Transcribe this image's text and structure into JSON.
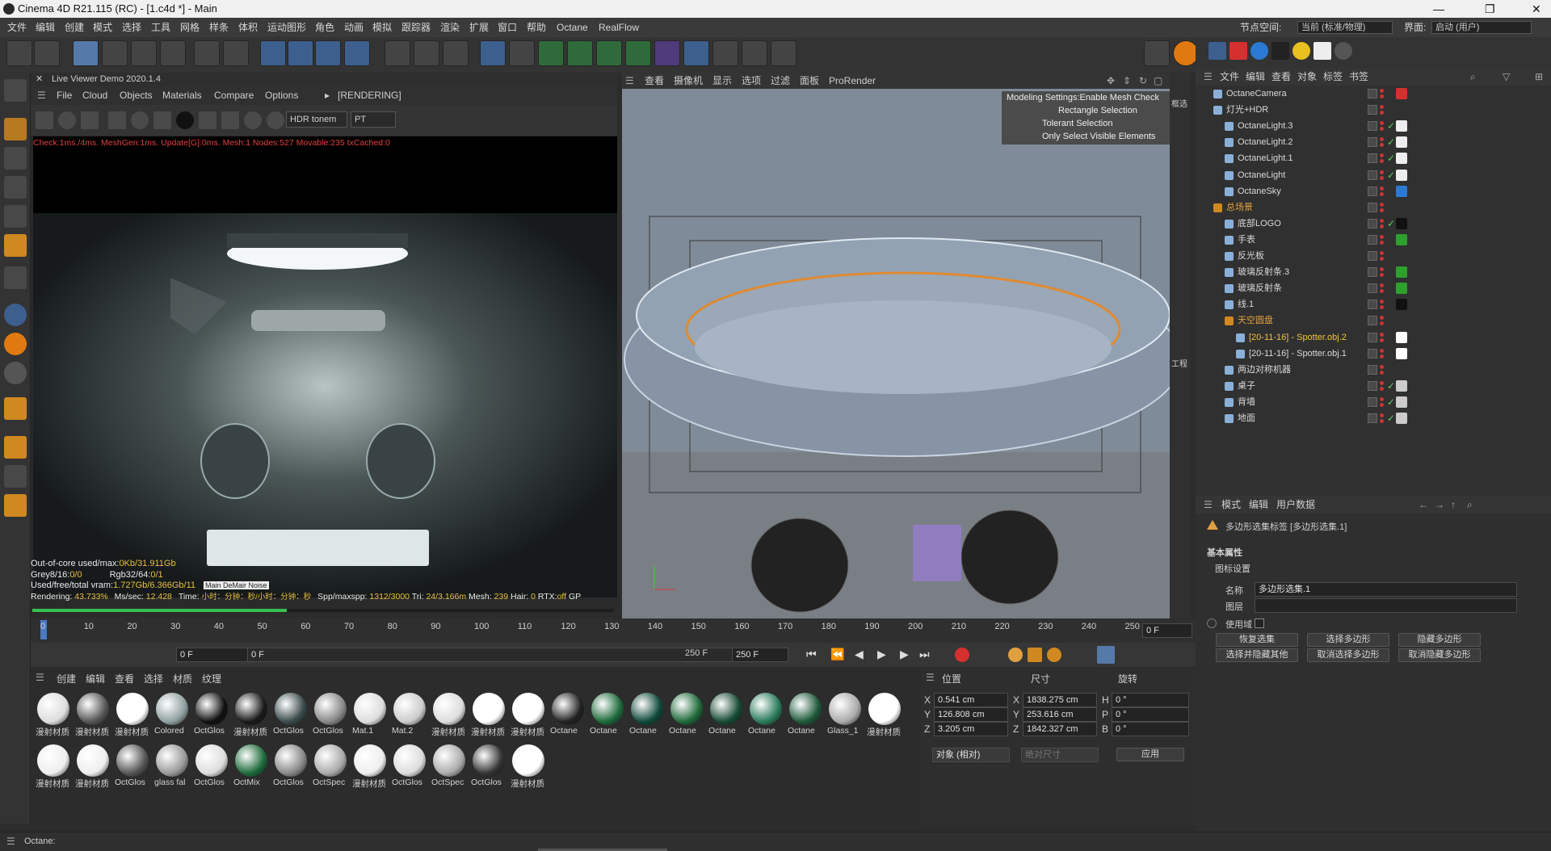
{
  "window": {
    "title": "Cinema 4D R21.115 (RC) - [1.c4d *] - Main",
    "min": "—",
    "max": "❐",
    "close": "✕"
  },
  "menu": {
    "items": [
      "文件",
      "编辑",
      "创建",
      "模式",
      "选择",
      "工具",
      "网格",
      "样条",
      "体积",
      "运动图形",
      "角色",
      "动画",
      "模拟",
      "跟踪器",
      "渲染",
      "扩展",
      "窗口",
      "帮助",
      "Octane",
      "RealFlow"
    ],
    "node_space_label": "节点空间:",
    "node_space_value": "当前 (标准/物理)",
    "layout_label": "界面:",
    "layout_value": "启动 (用户)"
  },
  "live_viewer": {
    "title": "Live Viewer Demo 2020.1.4",
    "menu": [
      "File",
      "Cloud",
      "Objects",
      "Materials",
      "Compare",
      "Options"
    ],
    "status": "[RENDERING]",
    "hdr_select": "HDR tonem",
    "pt_select": "PT",
    "check_line": "Check:1ms./4ms. MeshGen:1ms. Update[G]:0ms. Mesh:1 Nodes:527 Movable:235 txCached:0",
    "stats": {
      "l1_label": "Out-of-core used/max:",
      "l1_value": "0Kb/31.911Gb",
      "l2a_label": "Grey8/16:",
      "l2a_value": "0/0",
      "l2b_label": "Rgb32/64:",
      "l2b_value": "0/1",
      "l3_label": "Used/free/total vram:",
      "l3_value": "1.727Gb/6.366Gb/11",
      "l3_tag": "Main DeMair Noise",
      "r_label": "Rendering:",
      "r_value": "43.733%",
      "ms_label": "Ms/sec:",
      "ms_value": "12.428",
      "time_label": "Time:",
      "time_value": "小时：分钟：秒/小时：分钟：秒",
      "spp_label": "Spp/maxspp:",
      "spp_value": "1312/3000",
      "tri_label": "Tri:",
      "tri_value": "24/3.166m",
      "mesh_label": "Mesh:",
      "mesh_value": "239",
      "hair_label": "Hair:",
      "hair_value": "0",
      "rtx_label": "RTX:",
      "rtx_value": "off",
      "gp": "GP"
    },
    "progress": 0.437
  },
  "viewport": {
    "menu": [
      "查看",
      "摄像机",
      "显示",
      "选项",
      "过滤",
      "面板",
      "ProRender"
    ],
    "tooltip": [
      "Modeling Settings:Enable Mesh Check",
      "Rectangle Selection",
      "Tolerant Selection",
      "Only Select Visible Elements"
    ],
    "side_labels": [
      "框选",
      "工程"
    ]
  },
  "object_manager": {
    "menu": [
      "文件",
      "编辑",
      "查看",
      "对象",
      "标签",
      "书签"
    ],
    "rows": [
      {
        "name": "OctaneCamera",
        "indent": 0,
        "color": "#d9d9d9"
      },
      {
        "name": "灯光+HDR",
        "indent": 0,
        "color": "#d9d9d9"
      },
      {
        "name": "OctaneLight.3",
        "indent": 1,
        "color": "#d9d9d9"
      },
      {
        "name": "OctaneLight.2",
        "indent": 1,
        "color": "#d9d9d9"
      },
      {
        "name": "OctaneLight.1",
        "indent": 1,
        "color": "#d9d9d9"
      },
      {
        "name": "OctaneLight",
        "indent": 1,
        "color": "#d9d9d9"
      },
      {
        "name": "OctaneSky",
        "indent": 1,
        "color": "#d9d9d9"
      },
      {
        "name": "总场景",
        "indent": 0,
        "color": "#e0a040"
      },
      {
        "name": "底部LOGO",
        "indent": 1,
        "color": "#d9d9d9"
      },
      {
        "name": "手表",
        "indent": 1,
        "color": "#d9d9d9"
      },
      {
        "name": "反光板",
        "indent": 1,
        "color": "#d9d9d9"
      },
      {
        "name": "玻璃反射条.3",
        "indent": 1,
        "color": "#d9d9d9"
      },
      {
        "name": "玻璃反射条",
        "indent": 1,
        "color": "#d9d9d9"
      },
      {
        "name": "线.1",
        "indent": 1,
        "color": "#d9d9d9"
      },
      {
        "name": "天空圆盘",
        "indent": 1,
        "color": "#e0a040"
      },
      {
        "name": "[20-11-16] - Spotter.obj.2",
        "indent": 2,
        "color": "#f0c040"
      },
      {
        "name": "[20-11-16] - Spotter.obj.1",
        "indent": 2,
        "color": "#d9d9d9"
      },
      {
        "name": "两边对称机器",
        "indent": 1,
        "color": "#d9d9d9"
      },
      {
        "name": "桌子",
        "indent": 1,
        "color": "#d9d9d9"
      },
      {
        "name": "背墙",
        "indent": 1,
        "color": "#d9d9d9"
      },
      {
        "name": "地面",
        "indent": 1,
        "color": "#d9d9d9"
      }
    ]
  },
  "attributes": {
    "menu": [
      "模式",
      "编辑",
      "用户数据"
    ],
    "title": "多边形选集标签 [多边形选集.1]",
    "section": "基本属性",
    "sub": "图标设置",
    "name_label": "名称",
    "name_value": "多边形选集.1",
    "layer_label": "图层",
    "enable_label": "使用域",
    "buttons": [
      "恢复选集",
      "选择多边形",
      "隐藏多边形",
      "选择并隐藏其他",
      "取消选择多边形",
      "取消隐藏多边形"
    ]
  },
  "timeline": {
    "ticks": [
      "0",
      "10",
      "20",
      "30",
      "40",
      "50",
      "60",
      "70",
      "80",
      "90",
      "100",
      "110",
      "120",
      "130",
      "140",
      "150",
      "160",
      "170",
      "180",
      "190",
      "200",
      "210",
      "220",
      "230",
      "240",
      "250"
    ],
    "current": "0 F"
  },
  "transport": {
    "start": "0 F",
    "cur": "0 F",
    "end_a": "250 F",
    "end_b": "250 F"
  },
  "material_manager": {
    "menu": [
      "创建",
      "编辑",
      "查看",
      "选择",
      "材质",
      "纹理"
    ],
    "row1": [
      "漫射材质",
      "漫射材质",
      "漫射材质",
      "Colored",
      "OctGlos",
      "漫射材质",
      "OctGlos",
      "OctGlos",
      "Mat.1",
      "Mat.2",
      "漫射材质",
      "漫射材质",
      "漫射材质",
      "Octane",
      "Octane",
      "Octane",
      "Octane",
      "Octane",
      "Octane",
      "Octane",
      "Glass_1",
      "漫射材质"
    ],
    "row2": [
      "漫射材质",
      "漫射材质",
      "OctGlos",
      "glass fal",
      "OctGlos",
      "OctMix",
      "OctGlos",
      "OctSpec",
      "漫射材质",
      "OctGlos",
      "OctSpec",
      "OctGlos",
      "漫射材质"
    ]
  },
  "coordinates": {
    "headers": [
      "位置",
      "尺寸",
      "旋转"
    ],
    "rows": [
      {
        "axis": "X",
        "pos": "0.541 cm",
        "size_axis": "X",
        "size": "1838.275 cm",
        "rot_axis": "H",
        "rot": "0 °"
      },
      {
        "axis": "Y",
        "pos": "126.808 cm",
        "size_axis": "Y",
        "size": "253.616 cm",
        "rot_axis": "P",
        "rot": "0 °"
      },
      {
        "axis": "Z",
        "pos": "3.205 cm",
        "size_axis": "Z",
        "size": "1842.327 cm",
        "rot_axis": "B",
        "rot": "0 °"
      }
    ],
    "mode": "对象 (相对)",
    "size_mode": "绝对尺寸",
    "apply": "应用"
  },
  "status": {
    "text": "Octane:"
  },
  "colors": {
    "accent": "#5579a8",
    "orange": "#e0a040",
    "green": "#56d05c",
    "red": "#d43030"
  }
}
